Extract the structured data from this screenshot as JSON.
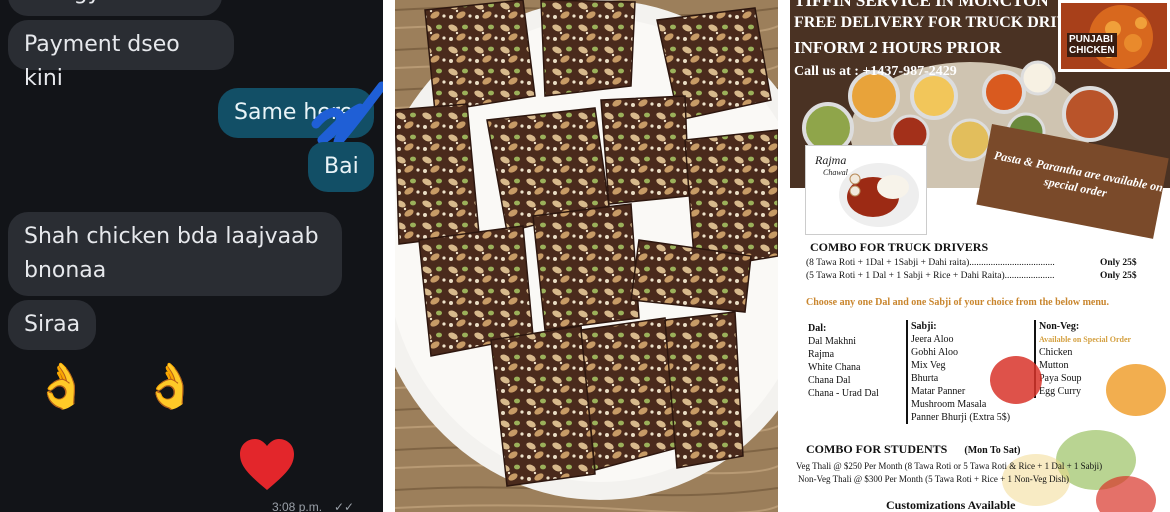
{
  "chat": {
    "messages": {
      "partial_top": "energy",
      "payment": "Payment dseo kini",
      "same_here": "Same here",
      "bai": "Bai",
      "shah_chicken_line1": "Shah chicken bda laajvaab",
      "shah_chicken_line2": "bnonaa",
      "siraa": "Siraa"
    },
    "reaction_emoji": "👌 👌",
    "heart_reaction": "♥",
    "timestamp": "3:08 p.m.",
    "read_ticks": "✓✓",
    "colors": {
      "background": "#121418",
      "incoming_bubble": "#2a2d33",
      "outgoing_bubble": "#124f66",
      "scribble": "#1f5fd6",
      "heart": "#e3262b"
    }
  },
  "photo": {
    "subject": "plate of date and nut energy bars with pistachios"
  },
  "flyer": {
    "title_line0": "TIFFIN SERVICE IN MONCTON",
    "title_line1": "FREE DELIVERY FOR TRUCK DRIVER",
    "title_line2": "INFORM 2 HOURS PRIOR",
    "call": "Call us at : +1437-987-2429",
    "punjabi_badge_line1": "PUNJABI",
    "punjabi_badge_line2": "CHICKEN",
    "rajma_label": "Rajma",
    "rajma_sub": "Chawal",
    "plank_text": "Pasta & Parantha are available on special order",
    "combo_truck": {
      "heading": "COMBO FOR TRUCK DRIVERS",
      "line1": "(8 Tawa Roti + 1Dal + 1Sabji + Dahi raita)....................................",
      "price1": "Only 25$",
      "line2": "(5 Tawa Roti + 1 Dal + 1 Sabji + Rice + Dahi Raita).....................",
      "price2": "Only 25$"
    },
    "choose_text": "Choose any one Dal and one Sabji of your choice from the below menu.",
    "dal": {
      "heading": "Dal:",
      "items": [
        "Dal Makhni",
        "Rajma",
        "White Chana",
        "Chana Dal",
        "Chana - Urad Dal"
      ]
    },
    "sabji": {
      "heading": "Sabji:",
      "items": [
        "Jeera Aloo",
        "Gobhi Aloo",
        "Mix Veg",
        "Bhurta",
        "Matar Panner",
        "Mushroom Masala",
        "Panner Bhurji (Extra 5$)"
      ]
    },
    "nonveg": {
      "heading": "Non-Veg:",
      "note": "Available on Special Order",
      "items": [
        "Chicken",
        "Mutton",
        "Paya Soup",
        "Egg Curry"
      ]
    },
    "students": {
      "heading": "COMBO FOR STUDENTS",
      "days": "(Mon To Sat)",
      "line1": "Veg Thali @ $250 Per Month  (8 Tawa Roti or 5 Tawa Roti & Rice  + 1 Dal + 1 Sabji)",
      "line2": "Non-Veg Thali @ $300 Per Month (5 Tawa Roti + Rice + 1 Non-Veg Dish)"
    },
    "customizations": "Customizations Available"
  }
}
